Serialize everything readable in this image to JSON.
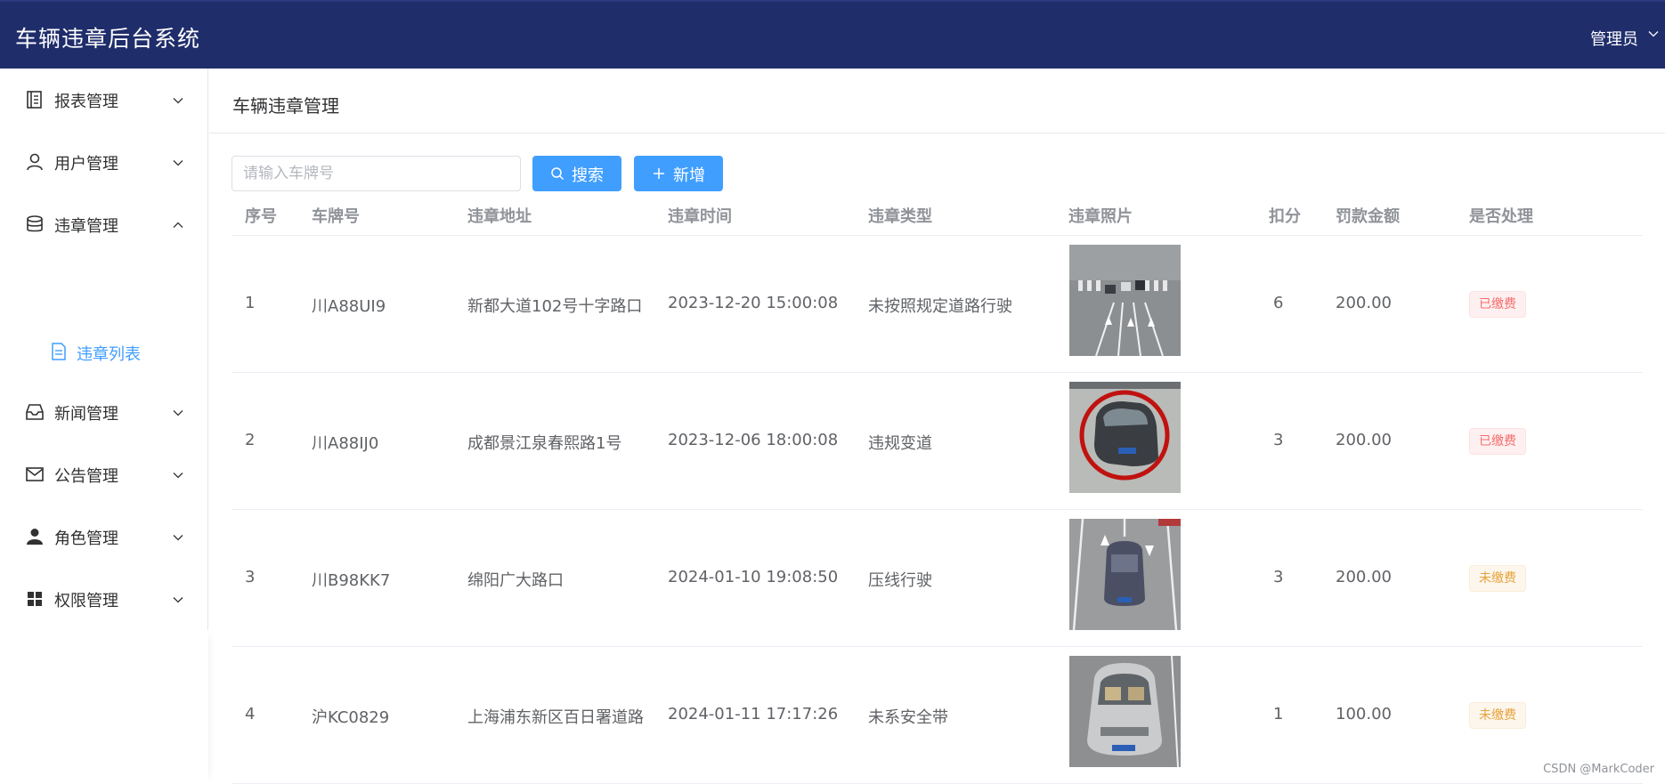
{
  "header": {
    "title": "车辆违章后台系统",
    "user": "管理员"
  },
  "sidebar": {
    "items": [
      {
        "label": "报表管理",
        "icon": "report-icon",
        "expanded": false
      },
      {
        "label": "用户管理",
        "icon": "user-icon",
        "expanded": false
      },
      {
        "label": "违章管理",
        "icon": "database-icon",
        "expanded": true
      },
      {
        "label": "新闻管理",
        "icon": "inbox-icon",
        "expanded": false
      },
      {
        "label": "公告管理",
        "icon": "mail-icon",
        "expanded": false
      },
      {
        "label": "角色管理",
        "icon": "role-icon",
        "expanded": false
      },
      {
        "label": "权限管理",
        "icon": "grid-icon",
        "expanded": false
      }
    ],
    "sub_item": {
      "label": "违章列表",
      "icon": "document-icon",
      "active": true
    }
  },
  "main": {
    "breadcrumb": "车辆违章管理",
    "search": {
      "placeholder": "请输入车牌号",
      "value": ""
    },
    "buttons": {
      "search": "搜索",
      "add": "新增"
    },
    "columns": [
      "序号",
      "车牌号",
      "违章地址",
      "违章时间",
      "违章类型",
      "违章照片",
      "扣分",
      "罚款金额",
      "是否处理"
    ],
    "rows": [
      {
        "index": "1",
        "plate": "川A88UI9",
        "address": "新都大道102号十字路口",
        "time": "2023-12-20 15:00:08",
        "type": "未按照规定道路行驶",
        "photo": "intersection-photo",
        "points": "6",
        "fine": "200.00",
        "status": "已缴费",
        "status_kind": "paid"
      },
      {
        "index": "2",
        "plate": "川A88IJ0",
        "address": "成都景江泉春熙路1号",
        "time": "2023-12-06 18:00:08",
        "type": "违规变道",
        "photo": "car-circled-photo",
        "points": "3",
        "fine": "200.00",
        "status": "已缴费",
        "status_kind": "paid"
      },
      {
        "index": "3",
        "plate": "川B98KK7",
        "address": "绵阳广大路口",
        "time": "2024-01-10 19:08:50",
        "type": "压线行驶",
        "photo": "lane-car-photo",
        "points": "3",
        "fine": "200.00",
        "status": "未缴费",
        "status_kind": "unpaid"
      },
      {
        "index": "4",
        "plate": "沪KC0829",
        "address": "上海浦东新区百日署道路",
        "time": "2024-01-11 17:17:26",
        "type": "未系安全带",
        "photo": "front-car-photo",
        "points": "1",
        "fine": "100.00",
        "status": "未缴费",
        "status_kind": "unpaid"
      }
    ]
  },
  "watermark": "CSDN @MarkCoder",
  "colors": {
    "header_bg": "#1f2d6b",
    "primary": "#409eff",
    "paid": "#f56c6c",
    "unpaid": "#e6a23c"
  }
}
